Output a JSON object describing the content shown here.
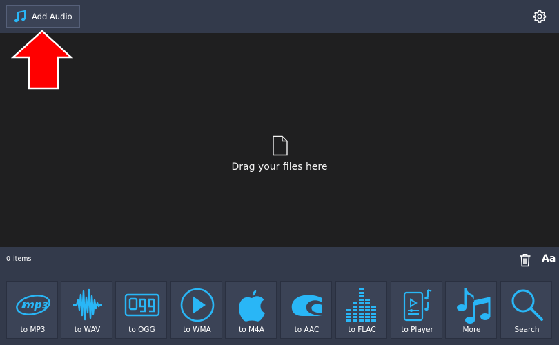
{
  "toolbar": {
    "add_audio_label": "Add Audio",
    "add_audio_icon": "music-note-icon",
    "settings_icon": "gear-icon"
  },
  "dropzone": {
    "icon": "file-icon",
    "text": "Drag your files here"
  },
  "status": {
    "count": "0",
    "unit": "items",
    "trash_icon": "trash-icon",
    "font_label": "Aa"
  },
  "formats": [
    {
      "label": "to MP3",
      "icon": "mp3-icon"
    },
    {
      "label": "to WAV",
      "icon": "waveform-icon"
    },
    {
      "label": "to OGG",
      "icon": "ogg-icon"
    },
    {
      "label": "to WMA",
      "icon": "play-icon"
    },
    {
      "label": "to M4A",
      "icon": "apple-icon"
    },
    {
      "label": "to AAC",
      "icon": "aac-icon"
    },
    {
      "label": "to FLAC",
      "icon": "equalizer-icon"
    },
    {
      "label": "to Player",
      "icon": "phone-player-icon"
    },
    {
      "label": "More",
      "icon": "music-notes-icon"
    },
    {
      "label": "Search",
      "icon": "search-icon"
    }
  ],
  "colors": {
    "accent": "#29b6f6",
    "toolbar_bg": "#333a4b",
    "button_bg": "#3b4356",
    "dropzone_bg": "#1f1f20",
    "annotation_arrow": "#ff0000"
  }
}
